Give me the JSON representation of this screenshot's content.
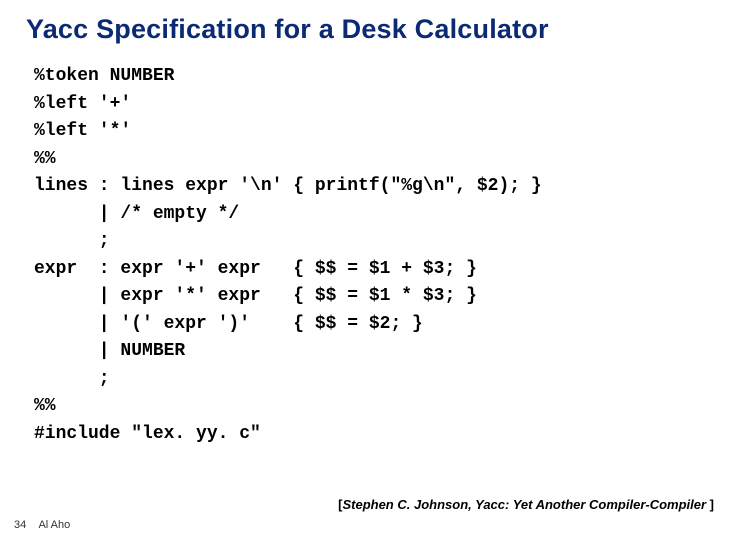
{
  "title": "Yacc Specification for a Desk Calculator",
  "code": "%token NUMBER\n%left '+'\n%left '*'\n%%\nlines : lines expr '\\n' { printf(\"%g\\n\", $2); }\n      | /* empty */\n      ;\nexpr  : expr '+' expr   { $$ = $1 + $3; }\n      | expr '*' expr   { $$ = $1 * $3; }\n      | '(' expr ')'    { $$ = $2; }\n      | NUMBER\n      ;\n%%\n#include \"lex. yy. c\"",
  "reference": {
    "left_bracket": "[",
    "text": "Stephen C. Johnson, Yacc: Yet Another Compiler-Compiler ",
    "right_bracket": "]"
  },
  "footer": {
    "page_number": "34",
    "author": "Al Aho"
  }
}
